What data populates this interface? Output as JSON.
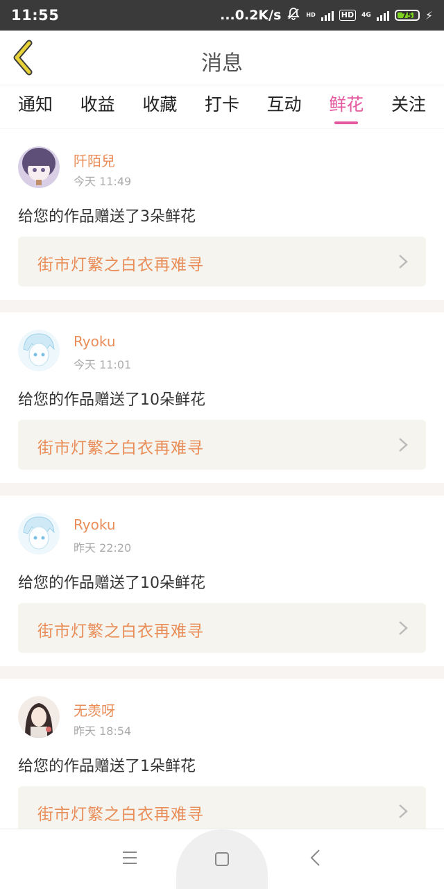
{
  "status_bar": {
    "time": "11:55",
    "network_speed": "...0.2K/s",
    "hd_label": "HD",
    "network_type": "4G",
    "battery": "75",
    "icons": [
      "mute-bell-icon",
      "signal-icon",
      "hd-icon",
      "signal-4g-icon",
      "battery-icon",
      "charging-icon"
    ]
  },
  "header": {
    "title": "消息",
    "back_icon": "chevron-left-icon",
    "accent_color": "#e8d23a"
  },
  "tabs": [
    {
      "label": "通知",
      "active": false
    },
    {
      "label": "收益",
      "active": false
    },
    {
      "label": "收藏",
      "active": false
    },
    {
      "label": "打卡",
      "active": false
    },
    {
      "label": "互动",
      "active": false
    },
    {
      "label": "鲜花",
      "active": true
    },
    {
      "label": "关注",
      "active": false
    }
  ],
  "colors": {
    "active_tab": "#e3589f",
    "username": "#e98d58",
    "work_title": "#e98d58"
  },
  "messages": [
    {
      "username": "阡陌兒",
      "time": "今天 11:49",
      "message": "给您的作品赠送了3朵鲜花",
      "work_title": "街市灯繁之白衣再难寻"
    },
    {
      "username": "Ryoku",
      "time": "今天 11:01",
      "message": "给您的作品赠送了10朵鲜花",
      "work_title": "街市灯繁之白衣再难寻"
    },
    {
      "username": "Ryoku",
      "time": "昨天 22:20",
      "message": "给您的作品赠送了10朵鲜花",
      "work_title": "街市灯繁之白衣再难寻"
    },
    {
      "username": "无羡呀",
      "time": "昨天 18:54",
      "message": "给您的作品赠送了1朵鲜花",
      "work_title": "街市灯繁之白衣再难寻"
    }
  ],
  "nav_bar": {
    "icons": [
      "menu-icon",
      "home-square-icon",
      "back-triangle-icon"
    ]
  }
}
